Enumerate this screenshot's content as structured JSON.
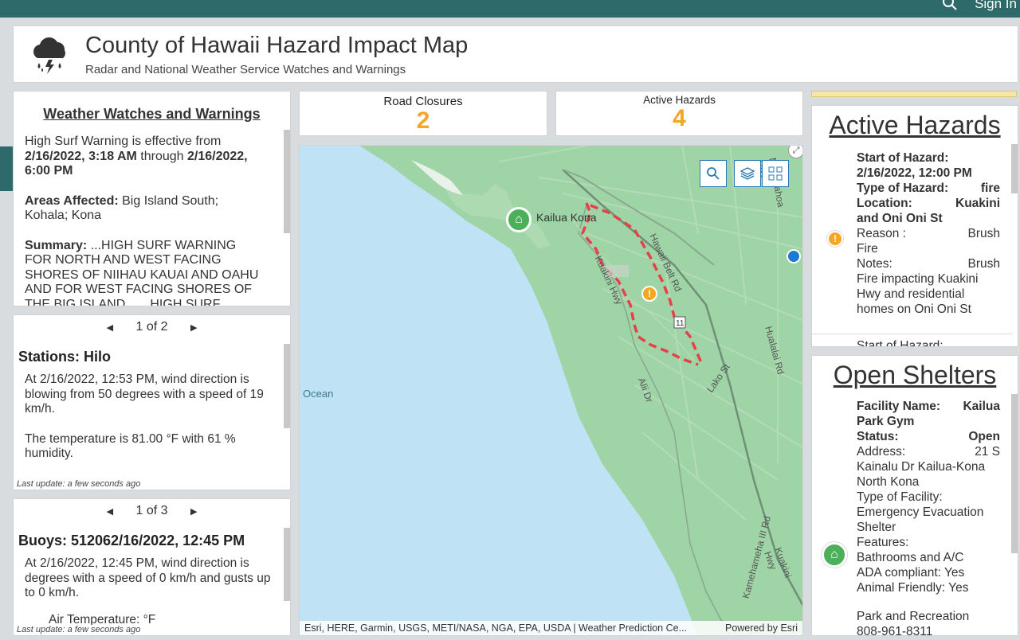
{
  "topbar": {
    "signin_label": "Sign In",
    "search_icon": "search-icon"
  },
  "header": {
    "title": "County of Hawaii Hazard Impact Map",
    "subtitle": "Radar and National Weather Service Watches and Warnings",
    "logo_icon": "storm-cloud-icon"
  },
  "weather": {
    "title": "Weather Watches and Warnings",
    "effective_prefix": "High Surf Warning is effective from",
    "from": "2/16/2022, 3:18 AM",
    "through_word": "through",
    "to": "2/16/2022, 6:00 PM",
    "areas_label": "Areas Affected:",
    "areas_value": "Big Island South; Kohala; Kona",
    "summary_label": "Summary:",
    "summary_value": "...HIGH SURF WARNING FOR NORTH AND WEST FACING SHORES OF NIIHAU KAUAI AND OAHU AND FOR WEST FACING SHORES OF THE BIG ISLAND... ...HIGH SURF ADVISORY FOR"
  },
  "stations": {
    "pager": "1 of 2",
    "title": "Stations: Hilo",
    "wind_text": "At 2/16/2022, 12:53 PM, wind direction is blowing from 50 degrees with a speed of 19 km/h.",
    "temp_text": "The temperature is 81.00 °F with 61 % humidity.",
    "last_update": "Last update: a few seconds ago"
  },
  "buoys": {
    "pager": "1 of 3",
    "title": "Buoys: 512062/16/2022, 12:45 PM",
    "wind_text": "At 2/16/2022, 12:45 PM, wind direction is degrees with a speed of 0 km/h and gusts up to 0 km/h.",
    "air_temp": "Air Temperature: °F",
    "last_update": "Last update: a few seconds ago"
  },
  "kpis": {
    "road_closures_label": "Road Closures",
    "road_closures_value": "2",
    "active_hazards_label": "Active Hazards",
    "active_hazards_value": "4",
    "value_color": "#f5a623"
  },
  "map": {
    "ocean_label": "Ocean",
    "town_label": "Kailua Kona",
    "road_labels": [
      "Hawaii Belt Rd",
      "Kuakini Hwy",
      "Alii Dr",
      "Lako St",
      "Hualalai Rd",
      "Kamehameha III Rd",
      "Mamalahoa Hwy",
      "Kuakini Hwy"
    ],
    "route_shield": "11",
    "attribution": "Esri, HERE, Garmin, USGS, METI/NASA, NGA, EPA, USDA | Weather Prediction Ce...",
    "powered_by": "Powered by Esri",
    "hazard_route_color": "#e8404a",
    "land_color": "#9fd4a6",
    "water_color": "#bfe3f4"
  },
  "active_hazards": {
    "title": "Active Hazards",
    "start_label": "Start of Hazard:",
    "start_value": "2/16/2022, 12:00 PM",
    "type_label": "Type of Hazard:",
    "type_value": "fire",
    "location_label": "Location:",
    "location_value": "Kuakini",
    "location_rest": "and Oni Oni St",
    "reason_label": "Reason :",
    "reason_value": "Brush",
    "reason_rest": "Fire",
    "notes_label": "Notes:",
    "notes_value": "Brush",
    "notes_rest": "Fire impacting Kuakini Hwy and residential homes on Oni Oni St",
    "next_item": "Start of Hazard:",
    "icon": "warning-icon"
  },
  "open_shelters": {
    "title": "Open Shelters",
    "facility_label": "Facility Name:",
    "facility_value": "Kailua",
    "facility_rest": "Park Gym",
    "status_label": "Status:",
    "status_value": "Open",
    "address_label": "Address:",
    "address_value": "21 S",
    "address_rest": "Kainalu Dr Kailua-Kona North Kona",
    "type_label": "Type of Facility:",
    "type_value": "Emergency Evacuation Shelter",
    "features_label": "Features:",
    "features_value": "Bathrooms and A/C",
    "ada_label": "ADA compliant:",
    "ada_value": "Yes",
    "animal_label": "Animal Friendly:",
    "animal_value": "Yes",
    "dept": "Park and Recreation",
    "phone": "808-961-8311",
    "icon": "shelter-icon"
  }
}
